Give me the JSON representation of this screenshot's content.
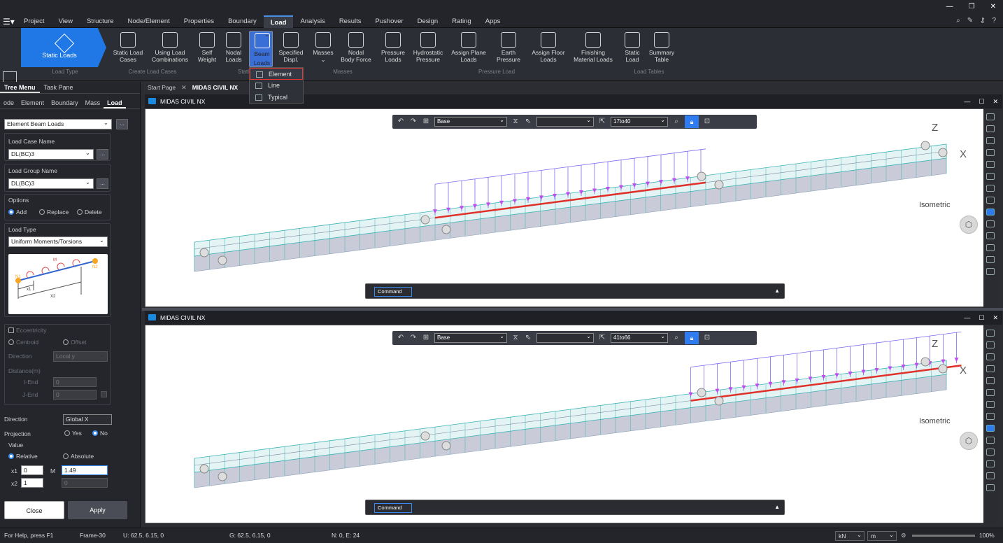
{
  "menu": {
    "tabs": [
      "Project",
      "View",
      "Structure",
      "Node/Element",
      "Properties",
      "Boundary",
      "Load",
      "Analysis",
      "Results",
      "Pushover",
      "Design",
      "Rating",
      "Apps"
    ],
    "active": "Load"
  },
  "ribbon": {
    "static_loads": "Static Loads",
    "load_type_group": "Load Type",
    "buttons": [
      {
        "l1": "Static Load",
        "l2": "Cases"
      },
      {
        "l1": "Using Load",
        "l2": "Combinations"
      },
      {
        "l1": "Self",
        "l2": "Weight"
      },
      {
        "l1": "Nodal",
        "l2": "Loads"
      },
      {
        "l1": "Beam",
        "l2": "Loads"
      },
      {
        "l1": "Specified",
        "l2": "Displ."
      },
      {
        "l1": "Masses",
        "l2": ""
      },
      {
        "l1": "Nodal",
        "l2": "Body Force"
      },
      {
        "l1": "Pressure",
        "l2": "Loads"
      },
      {
        "l1": "Hydrostatic",
        "l2": "Pressure"
      },
      {
        "l1": "Assign Plane",
        "l2": "Loads"
      },
      {
        "l1": "Earth",
        "l2": "Pressure"
      },
      {
        "l1": "Assign Floor",
        "l2": "Loads"
      },
      {
        "l1": "Finishing",
        "l2": "Material Loads"
      },
      {
        "l1": "Static",
        "l2": "Load"
      },
      {
        "l1": "Summary",
        "l2": "Table"
      }
    ],
    "groups": [
      "Create Load Cases",
      "Static",
      "Masses",
      "Pressure Load",
      "Load Tables"
    ]
  },
  "beam_dropdown": [
    "Element",
    "Line",
    "Typical"
  ],
  "panel": {
    "tabs": [
      "Tree Menu",
      "Task Pane"
    ],
    "subtabs": [
      "ode",
      "Element",
      "Boundary",
      "Mass",
      "Load"
    ],
    "function": "Element Beam Loads",
    "load_case_label": "Load Case Name",
    "load_case": "DL(BC)3",
    "load_group_label": "Load Group Name",
    "load_group": "DL(BC)3",
    "options_label": "Options",
    "opt_add": "Add",
    "opt_replace": "Replace",
    "opt_delete": "Delete",
    "load_type_label": "Load Type",
    "load_type": "Uniform Moments/Torsions",
    "diagram": {
      "n1": "N1",
      "n2": "N2",
      "m": "M",
      "x1": "x1",
      "x2": "X2"
    },
    "eccentricity": "Eccentricity",
    "centroid": "Centroid",
    "offset": "Offset",
    "direction_label": "Direction",
    "direction_ecc": "Local y",
    "distance": "Distance(m)",
    "iend": "I-End",
    "jend": "J-End",
    "iend_val": "0",
    "jend_val": "0",
    "direction2_label": "Direction",
    "direction2": "Global X",
    "projection": "Projection",
    "yes": "Yes",
    "no": "No",
    "value": "Value",
    "relative": "Relative",
    "absolute": "Absolute",
    "x1": "x1",
    "x1_val": "0",
    "m": "M",
    "m_val": "1.49",
    "x2": "x2",
    "x2_val": "1",
    "x2_m": "0",
    "close": "Close",
    "apply": "Apply"
  },
  "doc": {
    "tabs": [
      "Start Page",
      "MIDAS CIVIL NX"
    ]
  },
  "viewports": [
    {
      "title": "MIDAS CIVIL NX",
      "base": "Base",
      "range": "17to40",
      "command": "Command",
      "view": "Isometric",
      "z": "Z",
      "x": "X"
    },
    {
      "title": "MIDAS CIVIL NX",
      "base": "Base",
      "range": "41to66",
      "command": "Command",
      "view": "Isometric",
      "z": "Z",
      "x": "X"
    }
  ],
  "status": {
    "help": "For Help, press F1",
    "frame": "Frame-30",
    "u": "U: 62.5, 6.15, 0",
    "g": "G: 62.5, 6.15, 0",
    "ne": "N: 0, E: 24",
    "force": "kN",
    "length": "m",
    "zoom": "100%"
  },
  "colors": {
    "accent": "#1f78e6",
    "load": "#c04bf0",
    "beam": "#e0302a"
  }
}
